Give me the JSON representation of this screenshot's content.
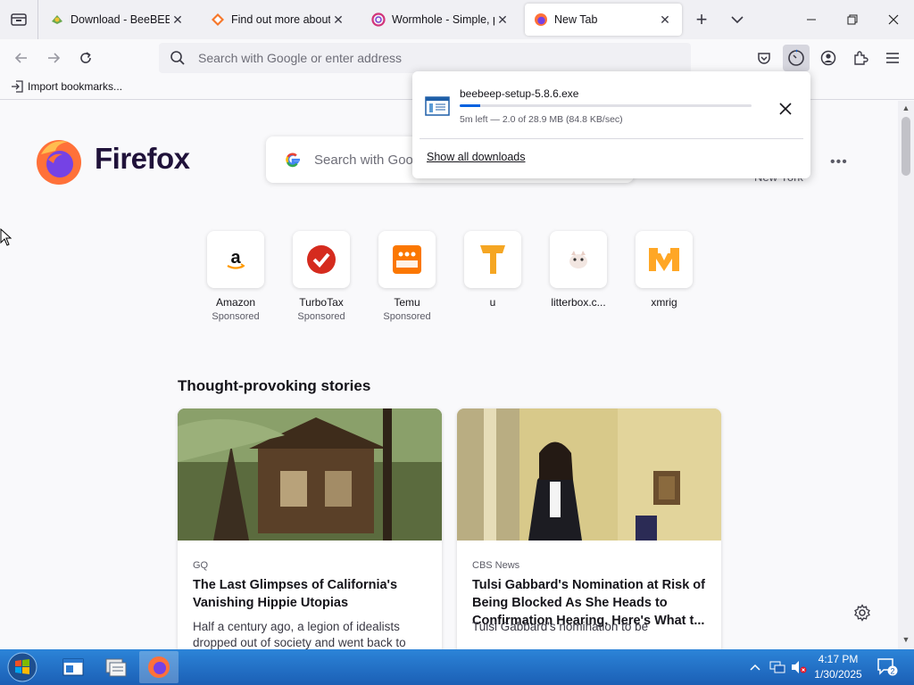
{
  "browser": {
    "tabs": [
      {
        "title": "Download - BeeBEEP - ",
        "favicon": "beebeep-icon"
      },
      {
        "title": "Find out more about Be",
        "favicon": "sourceforge-icon"
      },
      {
        "title": "Wormhole - Simple, pri",
        "favicon": "wormhole-icon"
      },
      {
        "title": "New Tab",
        "favicon": "firefox-icon",
        "active": true
      }
    ],
    "urlbar_placeholder": "Search with Google or enter address",
    "bookmark_label": "Import bookmarks..."
  },
  "newtab": {
    "brand": "Firefox",
    "search_placeholder": "Search with Google",
    "weather_location": "New York",
    "shortcuts": [
      {
        "label": "Amazon",
        "sponsored": "Sponsored",
        "icon": "amazon-icon"
      },
      {
        "label": "TurboTax",
        "sponsored": "Sponsored",
        "icon": "turbotax-icon"
      },
      {
        "label": "Temu",
        "sponsored": "Sponsored",
        "icon": "temu-icon"
      },
      {
        "label": "u",
        "sponsored": "",
        "icon": "u-icon"
      },
      {
        "label": "litterbox.c...",
        "sponsored": "",
        "icon": "litterbox-icon"
      },
      {
        "label": "xmrig",
        "sponsored": "",
        "icon": "xmrig-icon"
      }
    ],
    "stories_title": "Thought-provoking stories",
    "stories": [
      {
        "source": "GQ",
        "headline": "The Last Glimpses of California's Vanishing Hippie Utopias",
        "excerpt": "Half a century ago, a legion of idealists dropped out of society and went back to"
      },
      {
        "source": "CBS News",
        "headline": "Tulsi Gabbard's Nomination at Risk of Being Blocked As She Heads to Confirmation Hearing. Here's What t...",
        "excerpt": "Tulsi Gabbard's nomination to be"
      }
    ]
  },
  "download": {
    "filename": "beebeep-setup-5.8.6.exe",
    "status": "5m left — 2.0 of 28.9 MB (84.8 KB/sec)",
    "progress_fraction": 0.069,
    "show_all_label": "Show all downloads"
  },
  "taskbar": {
    "time": "4:17 PM",
    "date": "1/30/2025",
    "notification_count": "2"
  },
  "colors": {
    "accent": "#0061e0",
    "taskbar": "#1b5fb5"
  }
}
